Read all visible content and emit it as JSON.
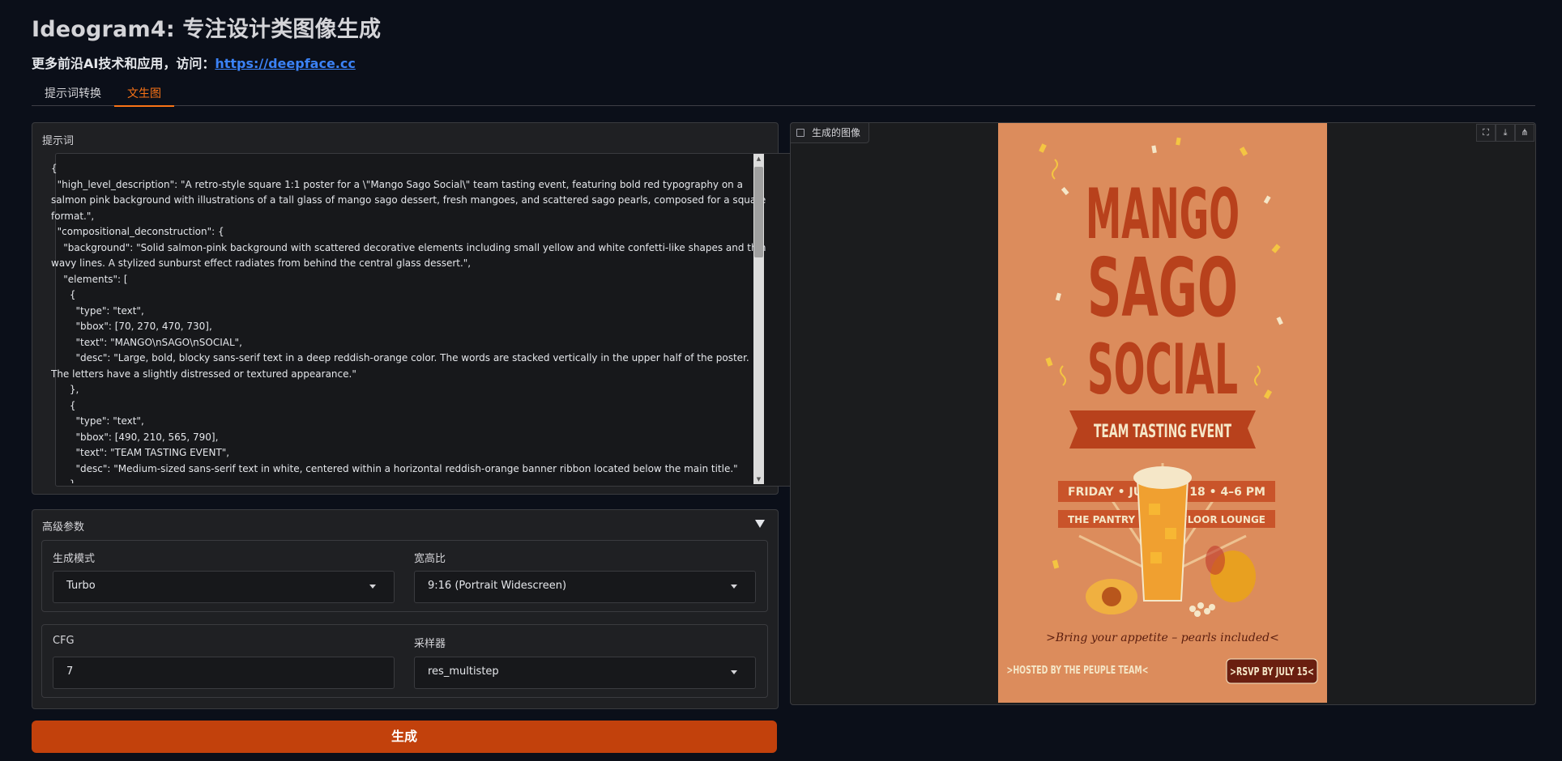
{
  "app": {
    "title": "Ideogram4: 专注设计类图像生成",
    "subtitle_prefix": "更多前沿AI技术和应用，访问：",
    "subtitle_link": "https://deepface.cc"
  },
  "tabs": [
    {
      "label": "提示词转换",
      "active": false
    },
    {
      "label": "文生图",
      "active": true
    }
  ],
  "prompt": {
    "label": "提示词",
    "value": "{\n  \"high_level_description\": \"A retro-style square 1:1 poster for a \\\"Mango Sago Social\\\" team tasting event, featuring bold red typography on a salmon pink background with illustrations of a tall glass of mango sago dessert, fresh mangoes, and scattered sago pearls, composed for a square format.\",\n  \"compositional_deconstruction\": {\n    \"background\": \"Solid salmon-pink background with scattered decorative elements including small yellow and white confetti-like shapes and thin wavy lines. A stylized sunburst effect radiates from behind the central glass dessert.\",\n    \"elements\": [\n      {\n        \"type\": \"text\",\n        \"bbox\": [70, 270, 470, 730],\n        \"text\": \"MANGO\\nSAGO\\nSOCIAL\",\n        \"desc\": \"Large, bold, blocky sans-serif text in a deep reddish-orange color. The words are stacked vertically in the upper half of the poster. The letters have a slightly distressed or textured appearance.\"\n      },\n      {\n        \"type\": \"text\",\n        \"bbox\": [490, 210, 565, 790],\n        \"text\": \"TEAM TASTING EVENT\",\n        \"desc\": \"Medium-sized sans-serif text in white, centered within a horizontal reddish-orange banner ribbon located below the main title.\"\n      },"
  },
  "advanced": {
    "label": "高级参数",
    "mode_label": "生成模式",
    "mode_value": "Turbo",
    "ratio_label": "宽高比",
    "ratio_value": "9:16 (Portrait Widescreen)",
    "cfg_label": "CFG",
    "cfg_value": "7",
    "sampler_label": "采样器",
    "sampler_value": "res_multistep"
  },
  "generate_button": "生成",
  "output": {
    "label": "生成的图像",
    "poster": {
      "title_lines": [
        "MANGO",
        "SAGO",
        "SOCIAL"
      ],
      "banner": "TEAM TASTING EVENT",
      "date_left": "FRIDAY • JUL",
      "date_right": "18 • 4–6 PM",
      "venue_left": "THE PANTRY •",
      "venue_right": "H FLOOR LOUNGE",
      "tagline": ">Bring your appetite – pearls included<",
      "host": ">HOSTED BY THE PEUPLE TEAM<",
      "rsvp": ">RSVP BY JULY 15<"
    }
  },
  "colors": {
    "accent": "#f97316",
    "button": "#c2410c",
    "poster_bg": "#dc8c5c",
    "poster_red": "#b8411c"
  }
}
